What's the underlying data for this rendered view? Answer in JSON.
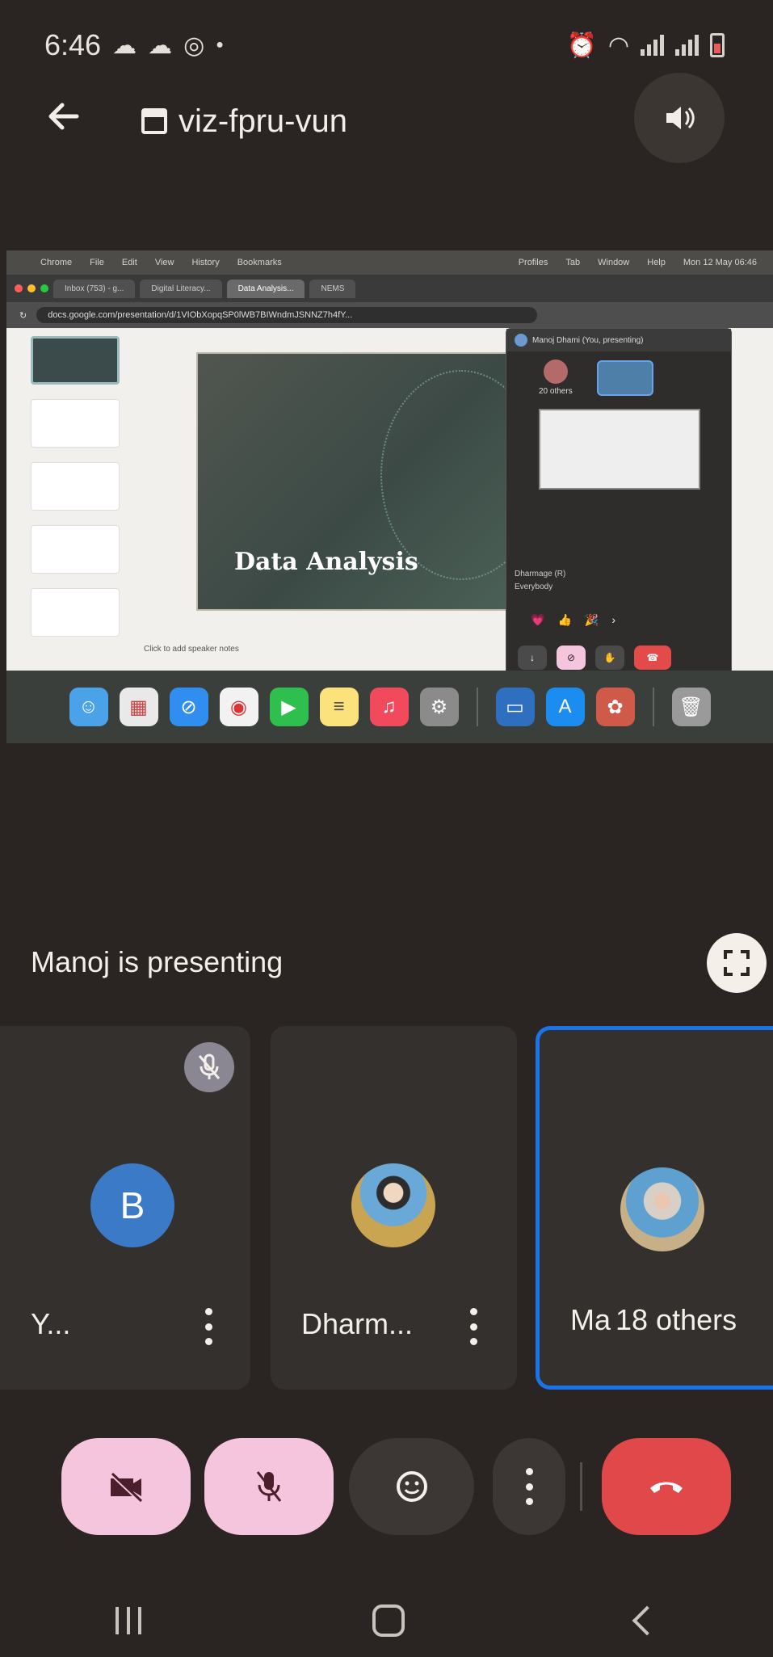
{
  "status_bar": {
    "time": "6:46"
  },
  "meeting": {
    "code": "viz-fpru-vun"
  },
  "shared_screen": {
    "mac_menu": [
      "Chrome",
      "File",
      "Edit",
      "View",
      "History",
      "Bookmarks",
      "Profiles",
      "Tab",
      "Window",
      "Help"
    ],
    "mac_clock": "Mon 12 May 06:46",
    "browser_tabs": [
      "Inbox (753) - g...",
      "Digital Literacy...",
      "Data Analysis...",
      "NEMS"
    ],
    "url": "docs.google.com/presentation/d/1VIObXopqSP0lWB7BIWndmJSNNZ7h4fY...",
    "meet_url": "meet.google.com",
    "slide_title": "Data Analysis",
    "speaker_notes": "Click to add speaker notes",
    "pip": {
      "presenter": "Manoj Dhami (You, presenting)",
      "others": "20 others",
      "chat_sender": "Dharmage (R)",
      "chat_text": "Everybody"
    }
  },
  "presenting_text": "Manoj is presenting",
  "participants": [
    {
      "initial": "B",
      "name": "Y...",
      "muted": true
    },
    {
      "name": "Dharm...",
      "muted": false
    },
    {
      "name": "Ma",
      "others_label": "18 others",
      "muted": false
    }
  ],
  "colors": {
    "background": "#2a2522",
    "tile": "#34302e",
    "active_border": "#1a73e8",
    "pink_button": "#f4c5dd",
    "end_call": "#e0484a",
    "avatar_blue": "#3a7ac7"
  },
  "controls": {
    "camera": "videocam-off-icon",
    "mic": "mic-off-icon",
    "emoji": "emoji-icon",
    "more": "more-vert-icon",
    "end": "call-end-icon"
  }
}
